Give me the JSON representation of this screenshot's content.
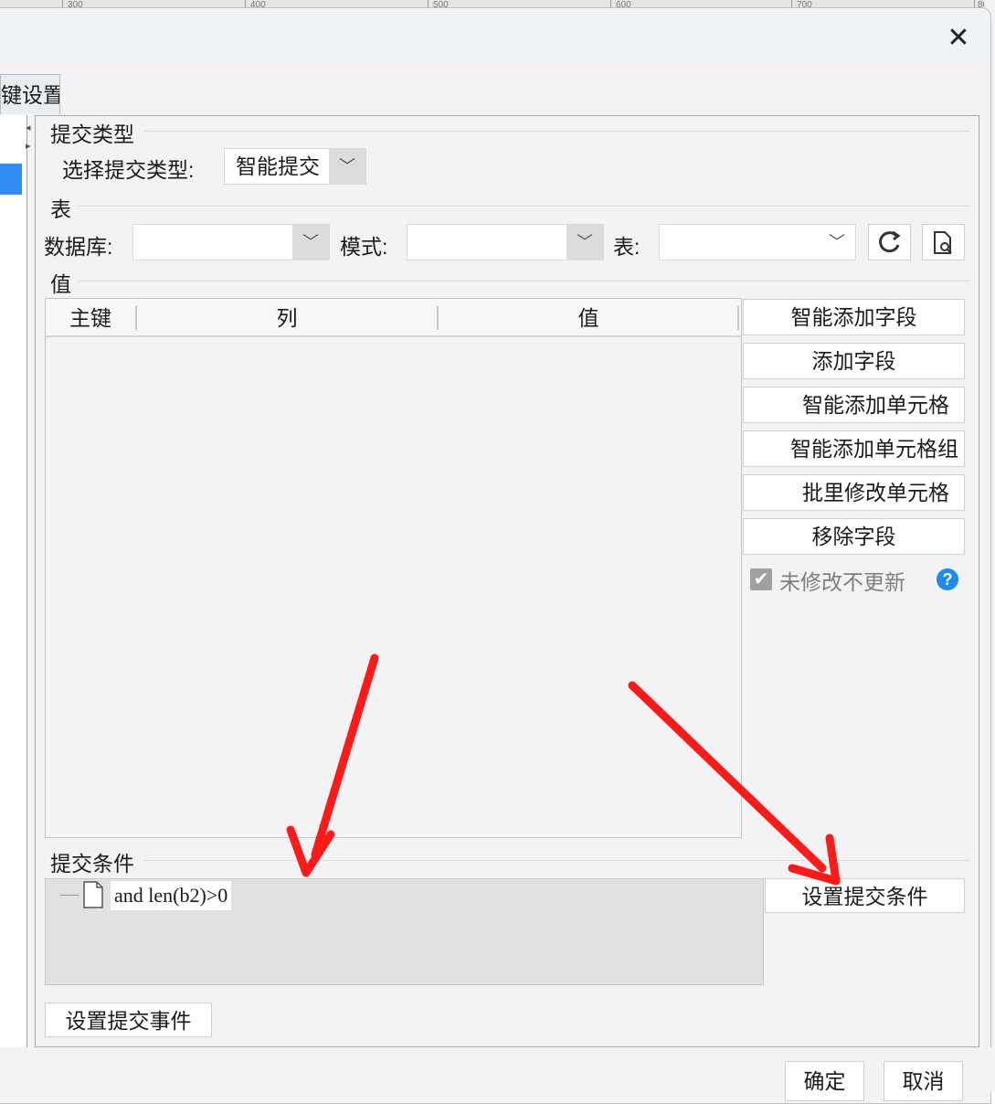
{
  "ruler": {
    "labels": [
      "300",
      "400",
      "500",
      "600",
      "700",
      "80"
    ]
  },
  "dialog": {
    "close_glyph": "✕"
  },
  "tabs": {
    "settings_label": "键设置"
  },
  "submit_type": {
    "section_label": "提交类型",
    "field_label": "选择提交类型:",
    "selected_value": "智能提交"
  },
  "table_section": {
    "section_label": "表",
    "database_label": "数据库:",
    "database_value": "",
    "mode_label": "模式:",
    "mode_value": "",
    "table_label": "表:",
    "table_value": ""
  },
  "value_section": {
    "section_label": "值",
    "columns": [
      "主键",
      "列",
      "值"
    ],
    "rows": []
  },
  "side_buttons": {
    "smart_add_field": "智能添加字段",
    "add_field": "添加字段",
    "smart_add_cell": "智能添加单元格",
    "smart_add_cell_group": "智能添加单元格组",
    "batch_modify_cells": "批里修改单元格",
    "remove_field": "移除字段"
  },
  "no_update_option": {
    "label": "未修改不更新",
    "checked": true,
    "help_glyph": "?"
  },
  "submit_condition": {
    "section_label": "提交条件",
    "condition_text": "and len(b2)>0",
    "set_button": "设置提交条件"
  },
  "submit_event": {
    "button": "设置提交事件"
  },
  "footer": {
    "ok_button": "确定",
    "cancel_button": "取消"
  },
  "colors": {
    "accent": "#2f8cf2",
    "help_blue": "#1f8bea",
    "annotation_red": "#ff1a1a"
  }
}
